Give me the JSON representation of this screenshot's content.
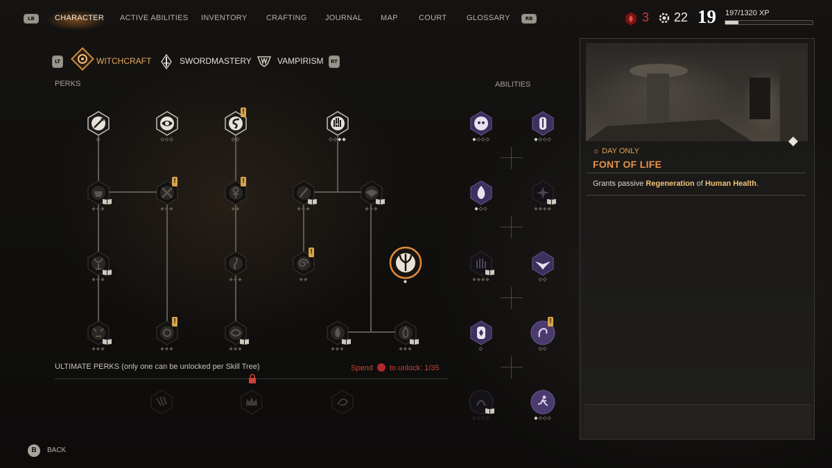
{
  "topnav": {
    "lb": "LB",
    "rb": "RB",
    "tabs": [
      {
        "label": "CHARACTER",
        "active": true
      },
      {
        "label": "ACTIVE ABILITIES"
      },
      {
        "label": "INVENTORY"
      },
      {
        "label": "CRAFTING"
      },
      {
        "label": "JOURNAL"
      },
      {
        "label": "MAP"
      },
      {
        "label": "COURT"
      },
      {
        "label": "GLOSSARY"
      }
    ],
    "blood_points": "3",
    "skill_points": "22",
    "level": "19",
    "xp_text": "197/1320 XP",
    "xp_progress": 0.149
  },
  "subtabs": {
    "lt": "LT",
    "rt": "RT",
    "items": [
      {
        "label": "WITCHCRAFT",
        "active": true,
        "icon": "witchcraft-icon"
      },
      {
        "label": "SWORDMASTERY",
        "icon": "sword-icon"
      },
      {
        "label": "VAMPIRISM",
        "icon": "fang-icon"
      }
    ]
  },
  "perks_label": "PERKS",
  "abilities_label": "ABILITIES",
  "ultimate_label": "ULTIMATE PERKS (only one can be unlocked per Skill Tree)",
  "spend_label_before": "Spend",
  "spend_label_after": "to unlock: 1/35",
  "detail": {
    "tag": "DAY ONLY",
    "title": "FONT OF LIFE",
    "desc_parts": [
      "Grants passive ",
      "Regeneration",
      " of ",
      "Human Health",
      "."
    ]
  },
  "back": {
    "button": "B",
    "label": "BACK"
  },
  "colors": {
    "accent": "#e9954a",
    "blood": "#d23a3a",
    "ability_purple": "#4a3a6e"
  }
}
